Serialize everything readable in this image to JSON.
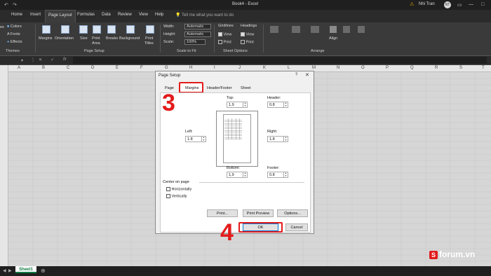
{
  "titlebar": {
    "document_title": "Book4 - Excel",
    "user_name": "Nhi Tran",
    "avatar_initials": "NT",
    "quick_access_icons": [
      "undo-icon",
      "redo-icon"
    ]
  },
  "tabs": [
    "Home",
    "Insert",
    "Page Layout",
    "Formulas",
    "Data",
    "Review",
    "View",
    "Help"
  ],
  "active_tab": "Page Layout",
  "tell_me": "Tell me what you want to do",
  "ribbon": {
    "themes": {
      "colors": "Colors",
      "fonts": "Fonts",
      "effects": "Effects",
      "theme_partial": "es",
      "group": "Themes"
    },
    "page_setup": {
      "margins": "Margins",
      "orientation": "Orientation",
      "size": "Size",
      "print_area_1": "Print",
      "print_area_2": "Area",
      "breaks": "Breaks",
      "background": "Background",
      "print_titles_1": "Print",
      "print_titles_2": "Titles",
      "group": "Page Setup"
    },
    "scale": {
      "width_label": "Width:",
      "width_value": "Automatic",
      "height_label": "Height:",
      "height_value": "Automatic",
      "scale_label": "Scale:",
      "scale_value": "100%",
      "group": "Scale to Fit"
    },
    "sheet_options": {
      "gridlines": "Gridlines",
      "headings": "Headings",
      "view": "View",
      "print": "Print",
      "group": "Sheet Options"
    },
    "arrange": {
      "align": "Align",
      "group": "Arrange",
      "disabled_items": [
        "Bring Forward",
        "Send Backward",
        "Selection Pane",
        "Group",
        "Rotate"
      ]
    }
  },
  "columns": [
    "A",
    "B",
    "C",
    "D",
    "E",
    "F",
    "G",
    "H",
    "I",
    "J",
    "K",
    "L",
    "M",
    "N",
    "O",
    "P",
    "Q",
    "R",
    "S",
    "T"
  ],
  "sheet_tab": "Sheet1",
  "dialog": {
    "title": "Page Setup",
    "help": "?",
    "tabs": [
      "Page",
      "Margins",
      "Header/Footer",
      "Sheet"
    ],
    "active_tab": "Margins",
    "top_label": "Top:",
    "top_value": "1,9",
    "header_label": "Header:",
    "header_value": "0.8",
    "left_label": "Left:",
    "left_value": "1.8",
    "right_label": "Right:",
    "right_value": "1.8",
    "bottom_label": "Bottom:",
    "bottom_value": "1,9",
    "footer_label": "Footer:",
    "footer_value": "0.8",
    "center_on_page": "Center on page",
    "horizontally": "Horizontally",
    "vertically": "Vertically",
    "print_button": "Print...",
    "print_preview_button": "Print Preview",
    "options_button": "Options...",
    "ok_button": "OK",
    "cancel_button": "Cancel"
  },
  "annotations": {
    "step3": "3",
    "step4": "4"
  },
  "watermark": {
    "logo": "S",
    "text": "forum.vn"
  },
  "colors": {
    "excel_green": "#107c41",
    "annotation_red": "#e21b1b",
    "dark_bg": "#1f1f1f"
  }
}
